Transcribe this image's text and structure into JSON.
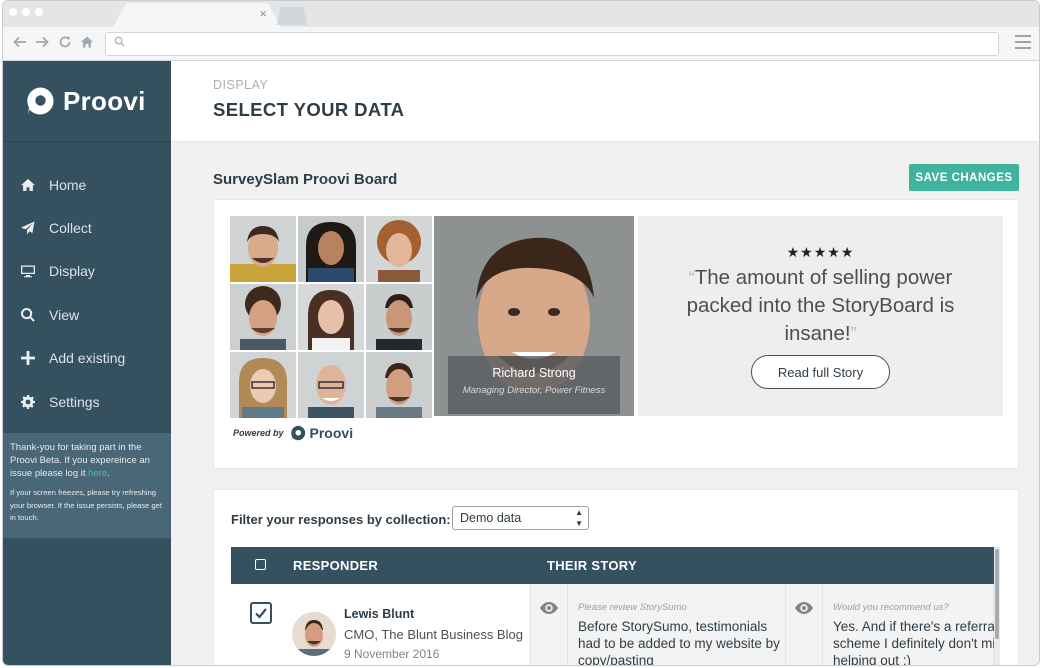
{
  "browser": {
    "tab_close": "×"
  },
  "brand": {
    "name": "Proovi"
  },
  "sidebar": {
    "items": [
      {
        "label": "Home",
        "icon": "home-icon"
      },
      {
        "label": "Collect",
        "icon": "send-icon"
      },
      {
        "label": "Display",
        "icon": "monitor-icon"
      },
      {
        "label": "View",
        "icon": "search-icon"
      },
      {
        "label": "Add existing",
        "icon": "plus-icon"
      },
      {
        "label": "Settings",
        "icon": "gear-icon"
      }
    ],
    "beta_text_1": "Thank-you for taking part in the Proovi Beta. If you expereince an issue please log it ",
    "beta_link": "here",
    "beta_text_2": ".",
    "beta_small": "If your screen freezes, please try refreshing your browser. If the issue persists, please get in touch."
  },
  "page": {
    "pre_title": "DISPLAY",
    "title": "SELECT YOUR DATA"
  },
  "board": {
    "title": "SurveySlam Proovi Board",
    "save_label": "SAVE CHANGES",
    "featured_name": "Richard Strong",
    "featured_role": "Managing Director, Power Fitness",
    "stars": "★★★★★",
    "rating": 5,
    "quote_open": "“",
    "quote": "The amount of selling power packed into the StoryBoard is insane!",
    "quote_close": "”",
    "read_label": "Read full Story",
    "powered_label": "Powered by",
    "powered_name": "Proovi"
  },
  "responses": {
    "filter_label": "Filter your responses by collection:",
    "filter_value": "Demo data",
    "headers": {
      "responder": "RESPONDER",
      "story": "THEIR STORY"
    },
    "rows": [
      {
        "checked": true,
        "name": "Lewis Blunt",
        "role": "CMO, The Blunt Business Blog",
        "date": "9 November 2016",
        "stories": [
          {
            "question": "Please review StorySumo",
            "answer": "Before StorySumo, testimonials had to be added to my website by copy/pasting"
          },
          {
            "question": "Would you recommend us?",
            "answer": "Yes. And if there's a referral scheme I definitely don't mind helping out ;)"
          }
        ]
      }
    ]
  },
  "colors": {
    "sidebar": "#35505f",
    "accent": "#3fb39b",
    "link": "#3fc4a2"
  }
}
